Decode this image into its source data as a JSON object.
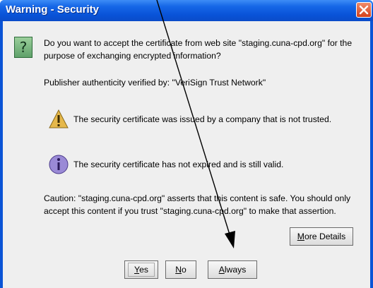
{
  "window": {
    "title": "Warning - Security"
  },
  "dialog": {
    "question_line1": "Do you want to accept the certificate from web site \"staging.cuna-cpd.org\" for the",
    "question_line2": "purpose of exchanging encrypted information?",
    "publisher_line": "Publisher authenticity verified by: \"VeriSign Trust Network\"",
    "warning_message": "The security certificate was issued by a company that is not trusted.",
    "info_message": "The security certificate has not expired and is still valid.",
    "caution_line1": "Caution: \"staging.cuna-cpd.org\" asserts that this content is safe. You should only",
    "caution_line2": "accept this content if you trust \"staging.cuna-cpd.org\" to make that assertion."
  },
  "buttons": {
    "more_details_prefix": "M",
    "more_details_rest": "ore Details",
    "yes_prefix": "Y",
    "yes_rest": "es",
    "no_prefix": "N",
    "no_rest": "o",
    "always_prefix": "A",
    "always_rest": "lways"
  },
  "icons": {
    "question": "question-icon",
    "warning": "warning-icon",
    "info": "info-icon",
    "close": "close-icon",
    "arrow": "annotation-arrow"
  },
  "colors": {
    "titlebar": "#0b54d6",
    "dialog_bg": "#efefef",
    "close_button": "#d4401a"
  }
}
